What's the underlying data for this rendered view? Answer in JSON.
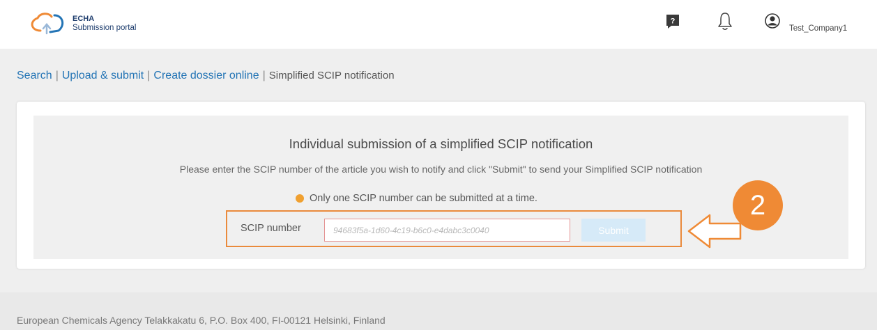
{
  "header": {
    "logo_title": "ECHA",
    "logo_subtitle": "Submission portal",
    "user_name": "Test_Company1"
  },
  "breadcrumb": {
    "items": [
      "Search",
      "Upload & submit",
      "Create dossier online"
    ],
    "separator": "|",
    "current": "Simplified SCIP notification"
  },
  "form": {
    "title": "Individual submission of a simplified SCIP notification",
    "instructions": "Please enter the SCIP number of the article you wish to notify and click \"Submit\" to send your Simplified SCIP notification",
    "note": "Only one SCIP number can be submitted at a time.",
    "field_label": "SCIP number",
    "placeholder": "94683f5a-1d60-4c19-b6c0-e4dabc3c0040",
    "submit_label": "Submit"
  },
  "annotation": {
    "step": "2"
  },
  "footer": {
    "address": "European Chemicals Agency Telakkakatu 6, P.O. Box 400, FI-00121 Helsinki, Finland"
  },
  "colors": {
    "link": "#2374b5",
    "accent_orange": "#ef8a35",
    "submit_disabled": "#d6eaf8",
    "input_border": "#e49494",
    "note_dot": "#f0a030"
  },
  "icons": [
    "echa-logo-icon",
    "help-icon",
    "bell-icon",
    "user-icon",
    "arrow-left-icon"
  ]
}
